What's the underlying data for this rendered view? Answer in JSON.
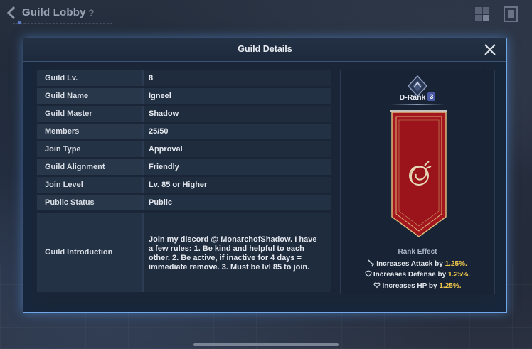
{
  "lobby": {
    "title": "Guild Lobby",
    "help": "?"
  },
  "modal": {
    "title": "Guild Details"
  },
  "info": [
    {
      "label": "Guild Lv.",
      "value": "8"
    },
    {
      "label": "Guild Name",
      "value": "Igneel"
    },
    {
      "label": "Guild Master",
      "value": "Shadow"
    },
    {
      "label": "Members",
      "value": "25/50"
    },
    {
      "label": "Join Type",
      "value": "Approval"
    },
    {
      "label": "Guild Alignment",
      "value": "Friendly"
    },
    {
      "label": "Join Level",
      "value": "Lv. 85 or Higher"
    },
    {
      "label": "Public Status",
      "value": "Public"
    },
    {
      "label": "Guild Introduction",
      "value": "Join my discord @ MonarchofShadow. I have a few rules: 1. Be kind and helpful to each other. 2. Be active, if inactive for 4 days = immediate remove. 3. Must be lvl 85 to join."
    }
  ],
  "rank": {
    "name": "D-Rank",
    "level": "3",
    "effect_title": "Rank Effect",
    "effects": [
      {
        "icon": "sword-icon",
        "text": "Increases Attack by ",
        "value": "1.25%."
      },
      {
        "icon": "shield-icon",
        "text": "Increases Defense by ",
        "value": "1.25%."
      },
      {
        "icon": "heart-icon",
        "text": "Increases HP by ",
        "value": "1.25%."
      }
    ]
  },
  "colors": {
    "accent": "#6fa6e6",
    "highlight": "#f2c84b",
    "banner": "#a3161d"
  }
}
